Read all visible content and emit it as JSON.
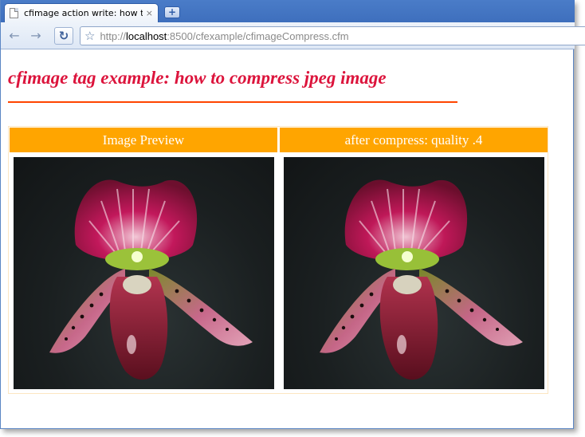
{
  "browser": {
    "tab_title": "cfimage action write: how t...",
    "tab_close": "×",
    "new_tab": "+",
    "url_prefix": "http://",
    "url_host": "localhost",
    "url_rest": ":8500/cfexample/cfimageCompress.cfm",
    "icons": [
      "page-icon",
      "close-icon",
      "new-tab-icon",
      "back-arrow-icon",
      "forward-arrow-icon",
      "reload-icon",
      "star-icon"
    ]
  },
  "page": {
    "heading": "cfimage tag example: how to compress jpeg image",
    "heading_color": "#dc143c",
    "rule_color": "#ff4500",
    "header_color": "#ffa500",
    "table": {
      "headers": [
        "Image Preview",
        "after compress: quality .4"
      ]
    }
  }
}
